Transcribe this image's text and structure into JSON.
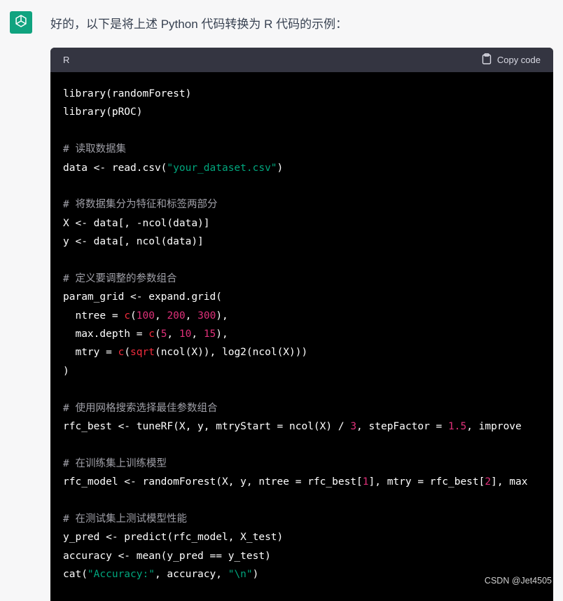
{
  "message": {
    "intro_text": "好的，以下是将上述 Python 代码转换为 R 代码的示例："
  },
  "code_block": {
    "language": "R",
    "copy_label": "Copy code",
    "lines": [
      [
        {
          "t": "plain",
          "v": "library(randomForest)"
        }
      ],
      [
        {
          "t": "plain",
          "v": "library(pROC)"
        }
      ],
      [],
      [
        {
          "t": "comment",
          "v": "# 读取数据集"
        }
      ],
      [
        {
          "t": "plain",
          "v": "data <- read.csv("
        },
        {
          "t": "string",
          "v": "\"your_dataset.csv\""
        },
        {
          "t": "plain",
          "v": ")"
        }
      ],
      [],
      [
        {
          "t": "comment",
          "v": "# 将数据集分为特征和标签两部分"
        }
      ],
      [
        {
          "t": "plain",
          "v": "X <- data[, -ncol(data)]"
        }
      ],
      [
        {
          "t": "plain",
          "v": "y <- data[, ncol(data)]"
        }
      ],
      [],
      [
        {
          "t": "comment",
          "v": "# 定义要调整的参数组合"
        }
      ],
      [
        {
          "t": "plain",
          "v": "param_grid <- expand.grid("
        }
      ],
      [
        {
          "t": "plain",
          "v": "  ntree = "
        },
        {
          "t": "func",
          "v": "c"
        },
        {
          "t": "plain",
          "v": "("
        },
        {
          "t": "number",
          "v": "100"
        },
        {
          "t": "plain",
          "v": ", "
        },
        {
          "t": "number",
          "v": "200"
        },
        {
          "t": "plain",
          "v": ", "
        },
        {
          "t": "number",
          "v": "300"
        },
        {
          "t": "plain",
          "v": "),"
        }
      ],
      [
        {
          "t": "plain",
          "v": "  max.depth = "
        },
        {
          "t": "func",
          "v": "c"
        },
        {
          "t": "plain",
          "v": "("
        },
        {
          "t": "number",
          "v": "5"
        },
        {
          "t": "plain",
          "v": ", "
        },
        {
          "t": "number",
          "v": "10"
        },
        {
          "t": "plain",
          "v": ", "
        },
        {
          "t": "number",
          "v": "15"
        },
        {
          "t": "plain",
          "v": "),"
        }
      ],
      [
        {
          "t": "plain",
          "v": "  mtry = "
        },
        {
          "t": "func",
          "v": "c"
        },
        {
          "t": "plain",
          "v": "("
        },
        {
          "t": "func",
          "v": "sqrt"
        },
        {
          "t": "plain",
          "v": "(ncol(X)), log2(ncol(X)))"
        }
      ],
      [
        {
          "t": "plain",
          "v": ")"
        }
      ],
      [],
      [
        {
          "t": "comment",
          "v": "# 使用网格搜索选择最佳参数组合"
        }
      ],
      [
        {
          "t": "plain",
          "v": "rfc_best <- tuneRF(X, y, mtryStart = ncol(X) / "
        },
        {
          "t": "number",
          "v": "3"
        },
        {
          "t": "plain",
          "v": ", stepFactor = "
        },
        {
          "t": "number",
          "v": "1.5"
        },
        {
          "t": "plain",
          "v": ", improve"
        }
      ],
      [],
      [
        {
          "t": "comment",
          "v": "# 在训练集上训练模型"
        }
      ],
      [
        {
          "t": "plain",
          "v": "rfc_model <- randomForest(X, y, ntree = rfc_best["
        },
        {
          "t": "number",
          "v": "1"
        },
        {
          "t": "plain",
          "v": "], mtry = rfc_best["
        },
        {
          "t": "number",
          "v": "2"
        },
        {
          "t": "plain",
          "v": "], max"
        }
      ],
      [],
      [
        {
          "t": "comment",
          "v": "# 在测试集上测试模型性能"
        }
      ],
      [
        {
          "t": "plain",
          "v": "y_pred <- predict(rfc_model, X_test)"
        }
      ],
      [
        {
          "t": "plain",
          "v": "accuracy <- mean(y_pred == y_test)"
        }
      ],
      [
        {
          "t": "plain",
          "v": "cat("
        },
        {
          "t": "string",
          "v": "\"Accuracy:\""
        },
        {
          "t": "plain",
          "v": ", accuracy, "
        },
        {
          "t": "string",
          "v": "\"\\n\""
        },
        {
          "t": "plain",
          "v": ")"
        }
      ]
    ]
  },
  "watermark": "CSDN @Jet4505",
  "colors": {
    "accent": "#10a37f",
    "code_background": "#000000",
    "code_header": "#343541",
    "string": "#00a67d",
    "number": "#df3079",
    "comment": "#a0a0a8"
  },
  "icons": {
    "avatar": "openai-logo-icon",
    "copy": "clipboard-icon"
  }
}
